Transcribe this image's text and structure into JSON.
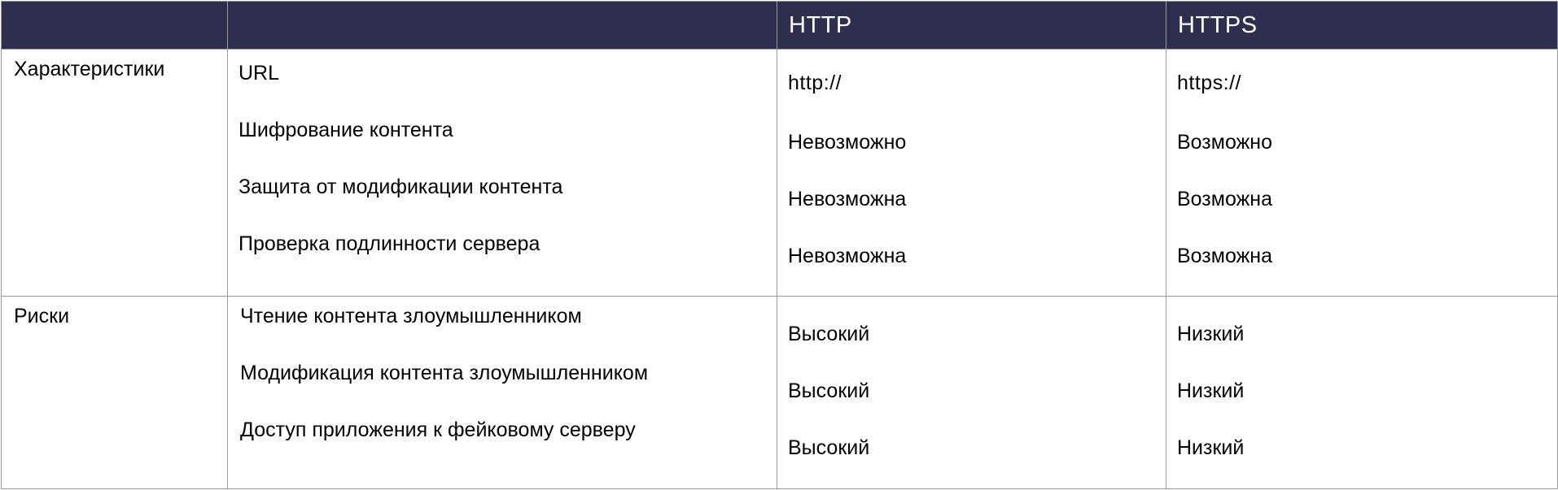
{
  "header": {
    "col1": "",
    "col2": "",
    "col3": "HTTP",
    "col4": "HTTPS"
  },
  "characteristics": {
    "label": "Характеристики",
    "items": [
      "URL",
      "Шифрование контента",
      "Защита от модификации контента",
      "Проверка подлинности сервера"
    ],
    "http": [
      "http://",
      "Невозможно",
      "Невозможна",
      "Невозможна"
    ],
    "https": [
      "https://",
      "Возможно",
      "Возможна",
      "Возможна"
    ]
  },
  "risks": {
    "label": "Риски",
    "items": [
      "Чтение контента злоумышленником",
      "Модификация контента злоумышленником",
      "Доступ приложения к фейковому серверу"
    ],
    "http": [
      "Высокий",
      "Высокий",
      "Высокий"
    ],
    "https": [
      "Низкий",
      "Низкий",
      "Низкий"
    ]
  },
  "colors": {
    "header_bg": "#2e2f4f",
    "header_text": "#ffffff",
    "border": "#9a9a9a"
  }
}
